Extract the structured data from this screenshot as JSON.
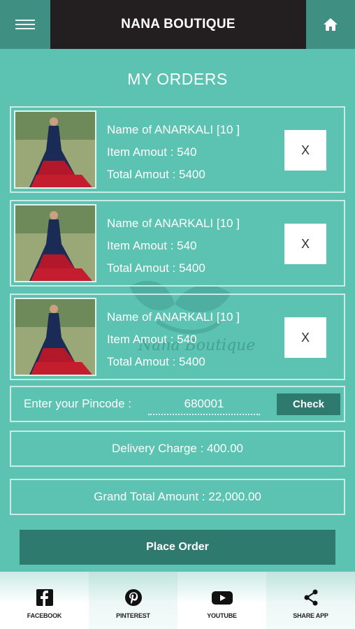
{
  "header": {
    "title": "NANA BOUTIQUE",
    "menu_icon": "hamburger-menu-icon",
    "home_icon": "home-icon"
  },
  "page": {
    "title": "MY ORDERS"
  },
  "orders": [
    {
      "name": "Name of ANARKALI [10 ]",
      "item_amount": "Item Amout : 540",
      "total_amount": "Total Amout : 5400",
      "remove_label": "X"
    },
    {
      "name": "Name of ANARKALI [10 ]",
      "item_amount": "Item Amout : 540",
      "total_amount": "Total Amout : 5400",
      "remove_label": "X"
    },
    {
      "name": "Name of ANARKALI [10 ]",
      "item_amount": "Item Amout : 540",
      "total_amount": "Total Amout : 5400",
      "remove_label": "X"
    }
  ],
  "watermark": {
    "text": "Nana Boutique"
  },
  "pincode": {
    "label": "Enter your Pincode  :",
    "value": "680001",
    "check_label": "Check"
  },
  "delivery": {
    "label": "Delivery Charge : 400.00"
  },
  "grand_total": {
    "label": "Grand Total Amount : 22,000.00"
  },
  "place_order": {
    "label": "Place Order"
  },
  "bottom_nav": [
    {
      "label": "FACEBOOK",
      "icon": "facebook-icon"
    },
    {
      "label": "PINTEREST",
      "icon": "pinterest-icon"
    },
    {
      "label": "YOUTUBE",
      "icon": "youtube-icon"
    },
    {
      "label": "SHARE APP",
      "icon": "share-icon"
    }
  ],
  "colors": {
    "background": "#5cc2b2",
    "header_dark": "#231f20",
    "accent_dark": "#2e7a6e"
  }
}
